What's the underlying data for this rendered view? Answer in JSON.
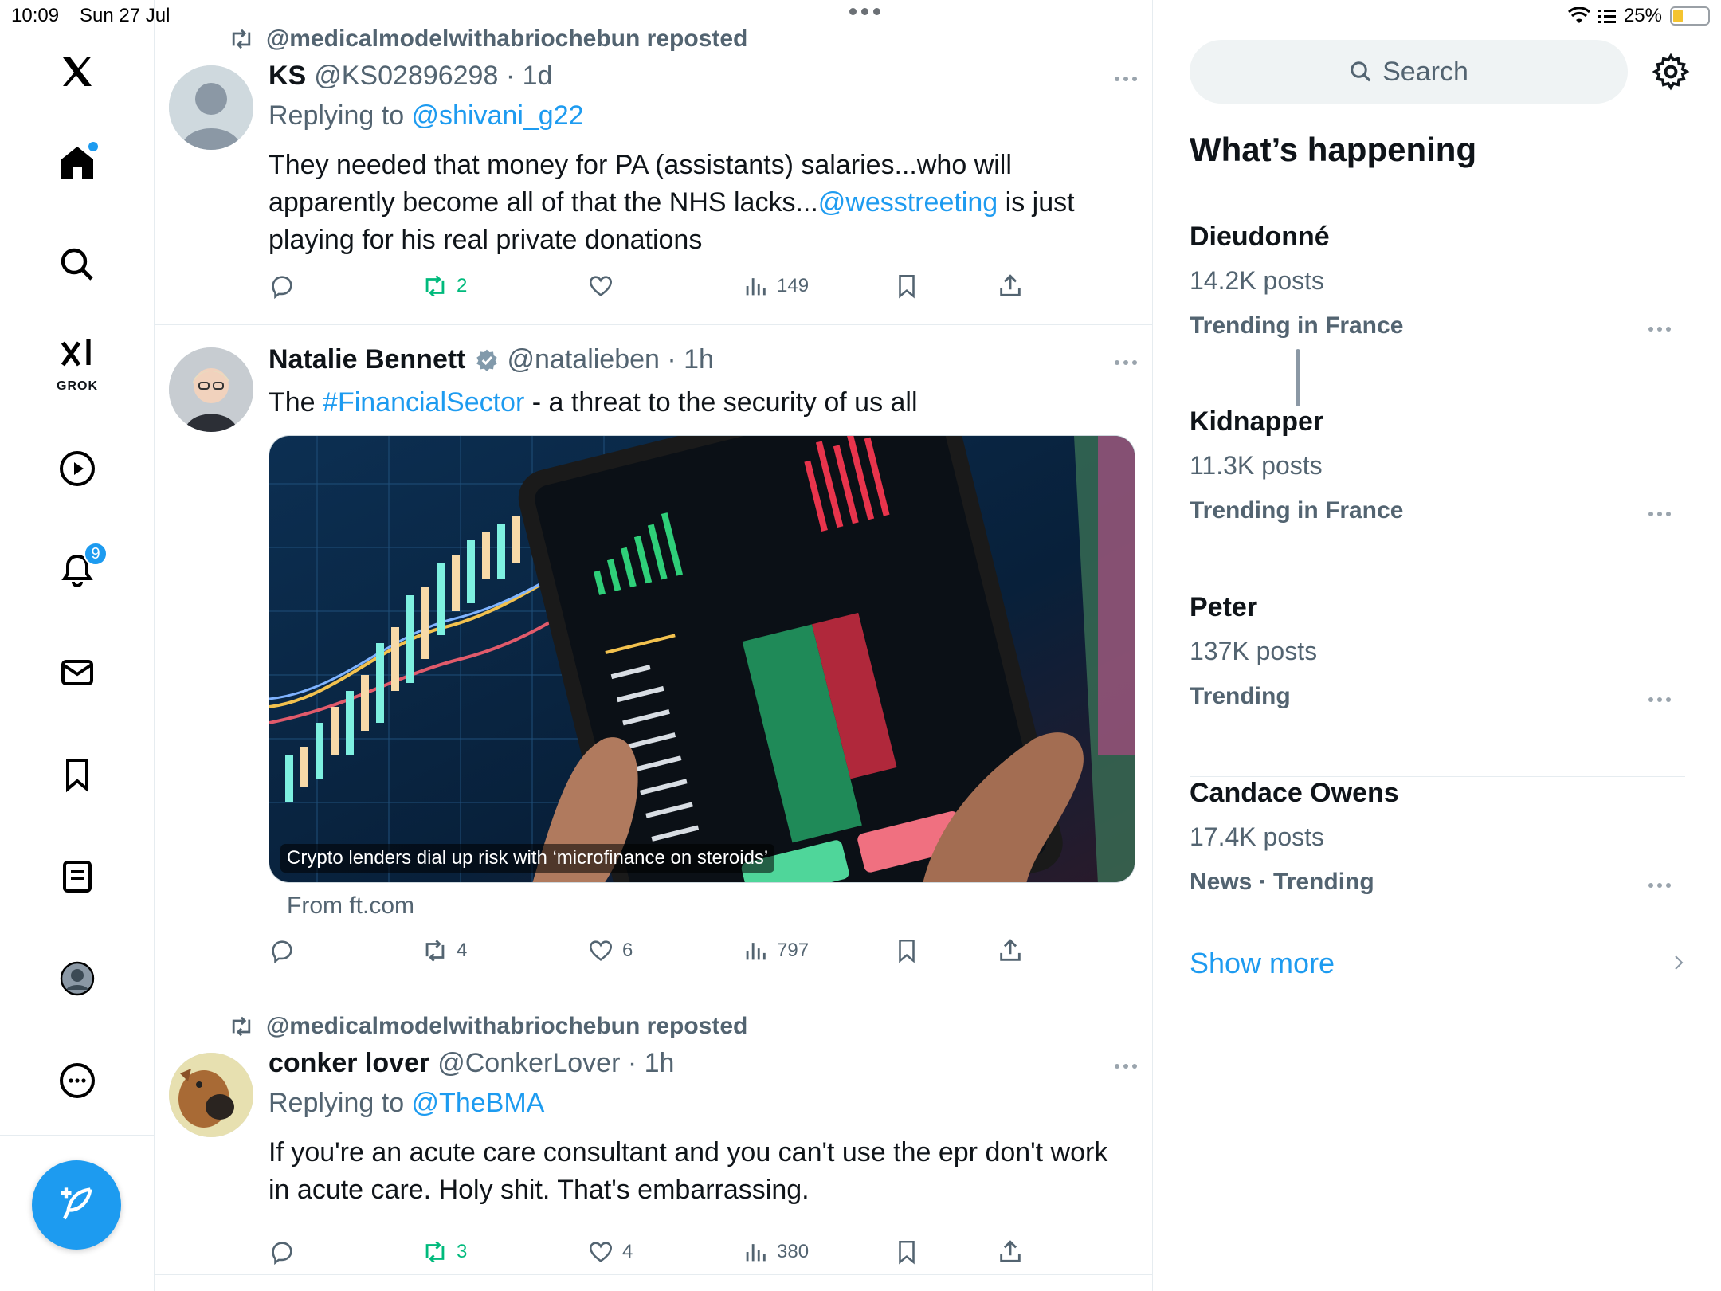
{
  "status_bar": {
    "time": "10:09",
    "date": "Sun 27 Jul",
    "battery": "25%"
  },
  "nav": {
    "notifications_badge": "9",
    "grok_label": "GROK"
  },
  "posts": [
    {
      "repost_by": "@medicalmodelwithabriochebun reposted",
      "name": "KS",
      "handle": "@KS02896298 · 1d",
      "replying_prefix": "Replying to ",
      "replying_to": "@shivani_g22",
      "text_part1": "They needed that money for PA (assistants) salaries...who will apparently become all of that the NHS lacks...",
      "text_mention": "@wesstreeting",
      "text_part2": "  is just playing for his real private donations",
      "retweets": "2",
      "likes": "",
      "views": "149"
    },
    {
      "name": "Natalie Bennett",
      "handle": "@natalieben · 1h",
      "text_prefix": "The ",
      "text_hashtag": "#FinancialSector",
      "text_suffix": " - a threat to the security of us all",
      "media_caption": "Crypto lenders dial up risk with ‘microfinance on steroids’",
      "source": "From ft.com",
      "retweets": "4",
      "likes": "6",
      "views": "797"
    },
    {
      "repost_by": "@medicalmodelwithabriochebun reposted",
      "name": "conker lover",
      "handle": "@ConkerLover · 1h",
      "replying_prefix": "Replying to ",
      "replying_to": "@TheBMA",
      "text": "If you're an acute care consultant and you can't use the epr don't work in acute care. Holy shit. That's embarrassing.",
      "retweets": "3",
      "likes": "4",
      "views": "380"
    }
  ],
  "sidebar": {
    "search_placeholder": "Search",
    "section_title": "What’s happening",
    "trends": [
      {
        "name": "Dieudonné",
        "count": "14.2K posts",
        "context": "Trending in France"
      },
      {
        "name": "Kidnapper",
        "count": "11.3K posts",
        "context": "Trending in France"
      },
      {
        "name": "Peter",
        "count": "137K posts",
        "context": "Trending"
      },
      {
        "name": "Candace Owens",
        "count": "17.4K posts",
        "context": "News · Trending"
      }
    ],
    "show_more": "Show more"
  },
  "colors": {
    "accent": "#1d9bf0",
    "retweet_green": "#00ba7c",
    "muted": "#536471"
  }
}
